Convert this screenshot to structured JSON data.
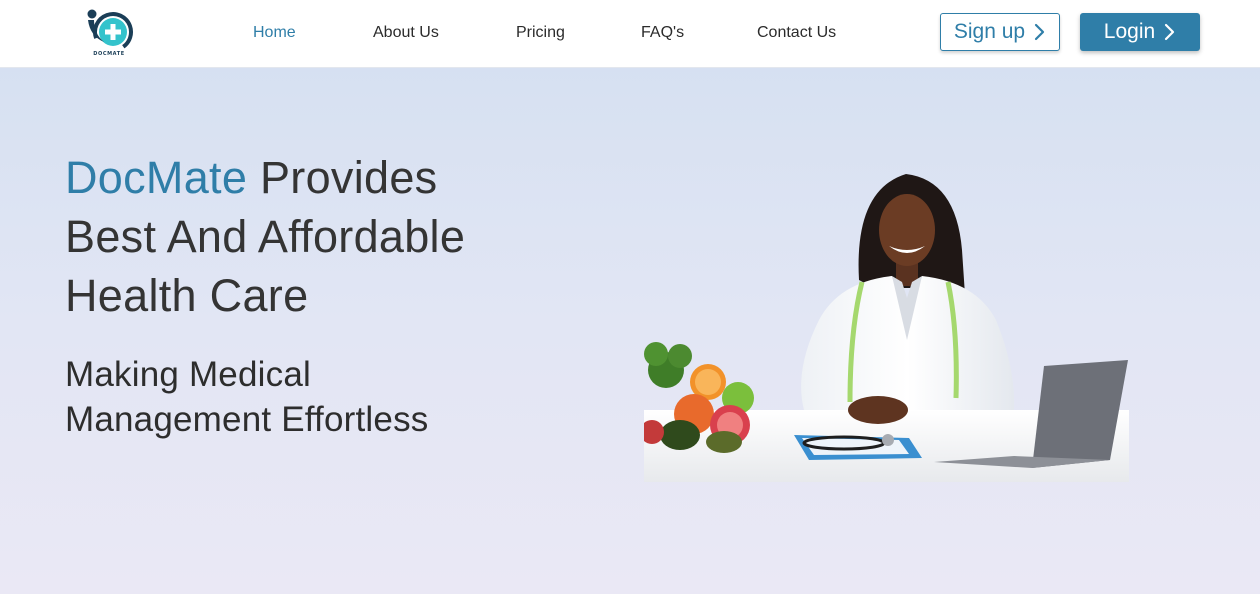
{
  "header": {
    "logo_text": "DOCMATE",
    "nav": [
      {
        "label": "Home",
        "active": true
      },
      {
        "label": "About Us",
        "active": false
      },
      {
        "label": "Pricing",
        "active": false
      },
      {
        "label": "FAQ's",
        "active": false
      },
      {
        "label": "Contact Us",
        "active": false
      }
    ],
    "signup_label": "Sign up",
    "login_label": "Login"
  },
  "hero": {
    "title_brand": "DocMate",
    "title_rest_1": " Provides",
    "title_line_2": "Best And Affordable",
    "title_line_3": "Health Care",
    "subtitle_line_1": "Making Medical",
    "subtitle_line_2": "Management Effortless"
  },
  "colors": {
    "accent": "#2f7ea8",
    "text": "#343434",
    "header_bg": "#ffffff"
  },
  "icons": [
    "docmate-logo-icon",
    "chevron-right-icon"
  ]
}
